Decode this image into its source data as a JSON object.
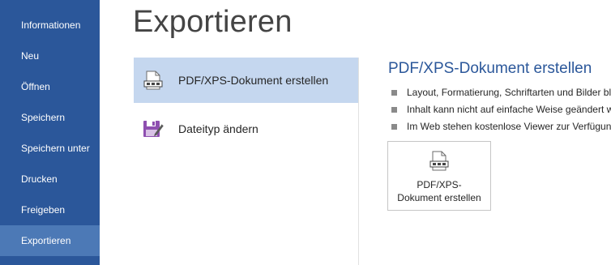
{
  "nav": {
    "items": [
      {
        "label": "Informationen"
      },
      {
        "label": "Neu"
      },
      {
        "label": "Öffnen"
      },
      {
        "label": "Speichern"
      },
      {
        "label": "Speichern unter"
      },
      {
        "label": "Drucken"
      },
      {
        "label": "Freigeben"
      },
      {
        "label": "Exportieren"
      }
    ],
    "active": "Exportieren",
    "background_color": "#2b579a",
    "active_color": "#4c79b6"
  },
  "page": {
    "title": "Exportieren"
  },
  "options": {
    "items": [
      {
        "label": "PDF/XPS-Dokument erstellen",
        "icon": "pdf-document-icon",
        "selected": true
      },
      {
        "label": "Dateityp ändern",
        "icon": "change-filetype-icon",
        "selected": false
      }
    ],
    "selected_color": "#c5d7ef"
  },
  "detail": {
    "title": "PDF/XPS-Dokument erstellen",
    "bullets": [
      "Layout, Formatierung, Schriftarten und Bilder bl",
      "Inhalt kann nicht auf einfache Weise geändert w",
      "Im Web stehen kostenlose Viewer zur Verfügung"
    ],
    "button": {
      "line1": "PDF/XPS-",
      "line2": "Dokument erstellen",
      "icon": "pdf-document-icon"
    }
  }
}
